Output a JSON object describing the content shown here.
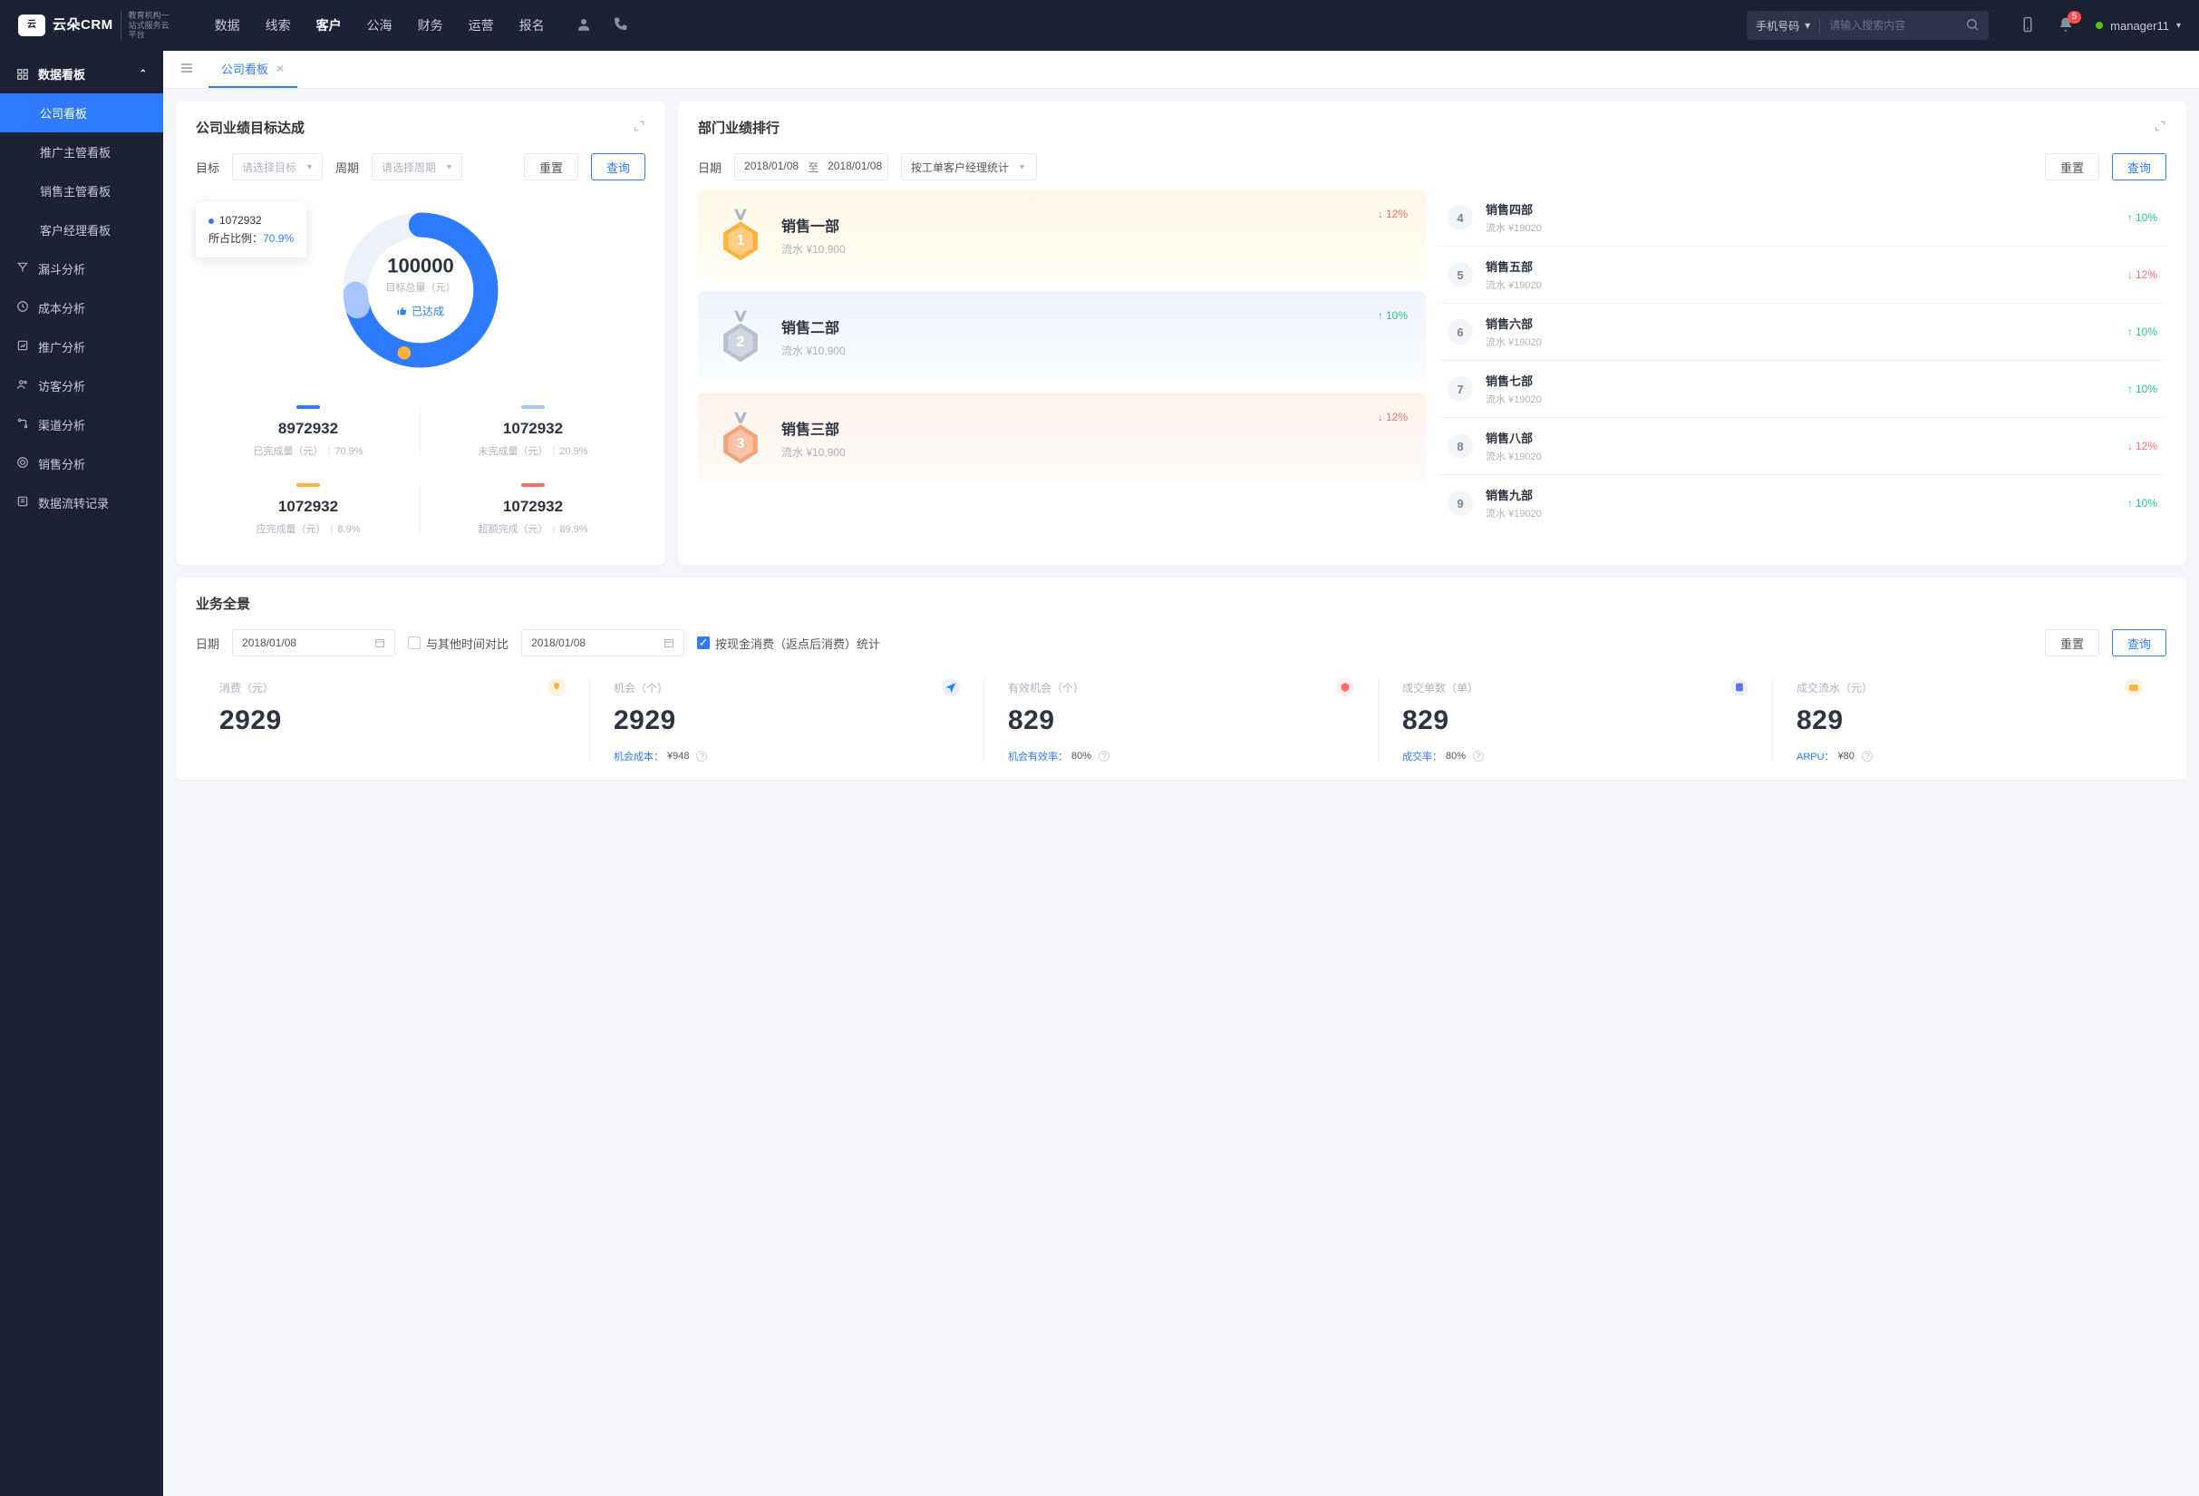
{
  "header": {
    "logo_text": "云朵CRM",
    "logo_sub": "教育机构一站式服务云平台",
    "nav": [
      "数据",
      "线索",
      "客户",
      "公海",
      "财务",
      "运营",
      "报名"
    ],
    "nav_active_index": 2,
    "search_type": "手机号码",
    "search_placeholder": "请输入搜索内容",
    "notif_count": "5",
    "username": "manager11"
  },
  "sidebar": {
    "group_label": "数据看板",
    "subs": [
      "公司看板",
      "推广主管看板",
      "销售主管看板",
      "客户经理看板"
    ],
    "sub_active_index": 0,
    "items": [
      "漏斗分析",
      "成本分析",
      "推广分析",
      "访客分析",
      "渠道分析",
      "销售分析",
      "数据流转记录"
    ]
  },
  "tab": {
    "label": "公司看板"
  },
  "target_card": {
    "title": "公司业绩目标达成",
    "filter_target_label": "目标",
    "filter_target_placeholder": "请选择目标",
    "filter_period_label": "周期",
    "filter_period_placeholder": "请选择周期",
    "btn_reset": "重置",
    "btn_query": "查询",
    "donut_total": "100000",
    "donut_total_label": "目标总量（元）",
    "donut_status": "已达成",
    "tooltip_value": "1072932",
    "tooltip_ratio_label": "所占比例：",
    "tooltip_ratio": "70.9%",
    "metrics": [
      {
        "bar": "#2f7bff",
        "value": "8972932",
        "label": "已完成量（元）",
        "pct": "70.9%"
      },
      {
        "bar": "#a7c6ff",
        "value": "1072932",
        "label": "未完成量（元）",
        "pct": "20.9%"
      },
      {
        "bar": "#ffb23e",
        "value": "1072932",
        "label": "应完成量（元）",
        "pct": "8.9%"
      },
      {
        "bar": "#ff6b6b",
        "value": "1072932",
        "label": "超额完成（元）",
        "pct": "89.9%"
      }
    ]
  },
  "rank_card": {
    "title": "部门业绩排行",
    "date_label": "日期",
    "date_from": "2018/01/08",
    "date_to_label": "至",
    "date_to": "2018/01/08",
    "stat_mode": "按工单客户经理统计",
    "btn_reset": "重置",
    "btn_query": "查询",
    "top": [
      {
        "rank": "1",
        "name": "销售一部",
        "sub": "流水 ¥10,900",
        "delta": "12%",
        "dir": "down",
        "theme": "gold"
      },
      {
        "rank": "2",
        "name": "销售二部",
        "sub": "流水 ¥10,900",
        "delta": "10%",
        "dir": "up",
        "theme": "silver"
      },
      {
        "rank": "3",
        "name": "销售三部",
        "sub": "流水 ¥10,900",
        "delta": "12%",
        "dir": "down",
        "theme": "bronze"
      }
    ],
    "list": [
      {
        "rank": "4",
        "name": "销售四部",
        "sub": "流水 ¥19020",
        "delta": "10%",
        "dir": "up"
      },
      {
        "rank": "5",
        "name": "销售五部",
        "sub": "流水 ¥19020",
        "delta": "12%",
        "dir": "down"
      },
      {
        "rank": "6",
        "name": "销售六部",
        "sub": "流水 ¥19020",
        "delta": "10%",
        "dir": "up"
      },
      {
        "rank": "7",
        "name": "销售七部",
        "sub": "流水 ¥19020",
        "delta": "10%",
        "dir": "up"
      },
      {
        "rank": "8",
        "name": "销售八部",
        "sub": "流水 ¥19020",
        "delta": "12%",
        "dir": "down"
      },
      {
        "rank": "9",
        "name": "销售九部",
        "sub": "流水 ¥19020",
        "delta": "10%",
        "dir": "up"
      }
    ]
  },
  "overview": {
    "title": "业务全景",
    "date_label": "日期",
    "date1": "2018/01/08",
    "compare_label": "与其他时间对比",
    "date2": "2018/01/08",
    "cash_stat_label": "按现金消费（返点后消费）统计",
    "btn_reset": "重置",
    "btn_query": "查询",
    "cells": [
      {
        "label": "消费（元）",
        "value": "2929",
        "foot_label": "",
        "foot_value": "",
        "icon_bg": "#fff3e0",
        "icon_color": "#ffb23e"
      },
      {
        "label": "机会（个）",
        "value": "2929",
        "foot_label": "机会成本：",
        "foot_value": "¥948",
        "icon_bg": "#e8f1ff",
        "icon_color": "#2f7bff"
      },
      {
        "label": "有效机会（个）",
        "value": "829",
        "foot_label": "机会有效率：",
        "foot_value": "80%",
        "icon_bg": "#ffecec",
        "icon_color": "#ff6b6b"
      },
      {
        "label": "成交单数（单）",
        "value": "829",
        "foot_label": "成交率：",
        "foot_value": "80%",
        "icon_bg": "#eef1ff",
        "icon_color": "#5a72ff"
      },
      {
        "label": "成交流水（元）",
        "value": "829",
        "foot_label": "ARPU：",
        "foot_value": "¥80",
        "icon_bg": "#fff3e0",
        "icon_color": "#ffb23e"
      }
    ]
  },
  "chart_data": {
    "type": "pie",
    "title": "公司业绩目标达成",
    "total": 100000,
    "total_label": "目标总量（元）",
    "series": [
      {
        "name": "已完成量（元）",
        "value": 8972932,
        "pct": 70.9,
        "color": "#2f7bff"
      },
      {
        "name": "未完成量（元）",
        "value": 1072932,
        "pct": 20.9,
        "color": "#a7c6ff"
      },
      {
        "name": "应完成量（元）",
        "value": 1072932,
        "pct": 8.9,
        "color": "#ffb23e"
      },
      {
        "name": "超额完成（元）",
        "value": 1072932,
        "pct": 89.9,
        "color": "#ff6b6b"
      }
    ],
    "tooltip": {
      "value": 1072932,
      "ratio": 70.9
    }
  }
}
